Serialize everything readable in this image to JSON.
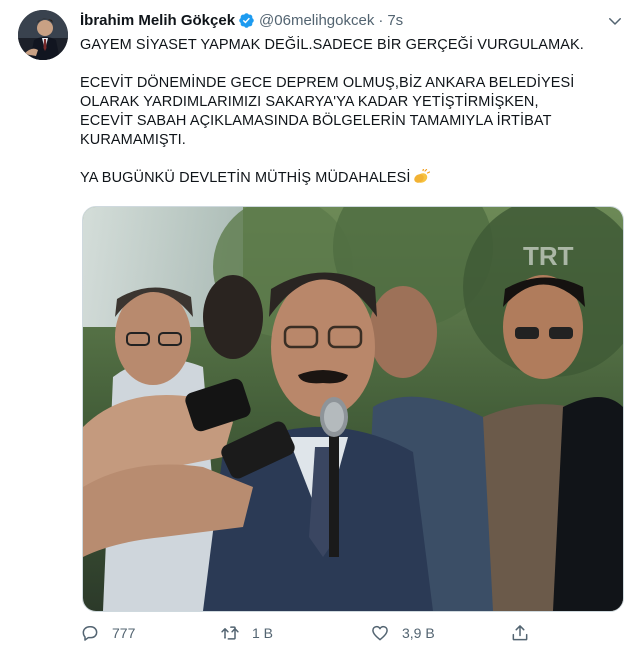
{
  "user": {
    "name": "İbrahim Melih Gökçek",
    "handle": "@06melihgokcek",
    "separator": "·",
    "time": "7s"
  },
  "tweet": {
    "lines": [
      "GAYEM SİYASET YAPMAK DEĞİL.SADECE BİR GERÇEĞİ VURGULAMAK.",
      "ECEVİT DÖNEMİNDE GECE DEPREM OLMUŞ,BİZ ANKARA BELEDİYESİ",
      "OLARAK YARDIMLARIMIZI SAKARYA'YA KADAR YETİŞTİRMİŞKEN,",
      "ECEVİT SABAH AÇIKLAMASINDA BÖLGELERİN TAMAMIYLA İRTİBAT",
      "KURAMAMIŞTI.",
      "YA BUGÜNKÜ DEVLETİN MÜTHİŞ MÜDAHALESİ"
    ],
    "emoji": "clapping-hands"
  },
  "media": {
    "watermark": "TRT"
  },
  "actions": {
    "reply_count": "777",
    "retweet_count": "1 B",
    "like_count": "3,9 B"
  },
  "colors": {
    "text": "#0f1419",
    "secondary": "#536471",
    "verified": "#1d9bf0",
    "border": "#cfd9de"
  }
}
